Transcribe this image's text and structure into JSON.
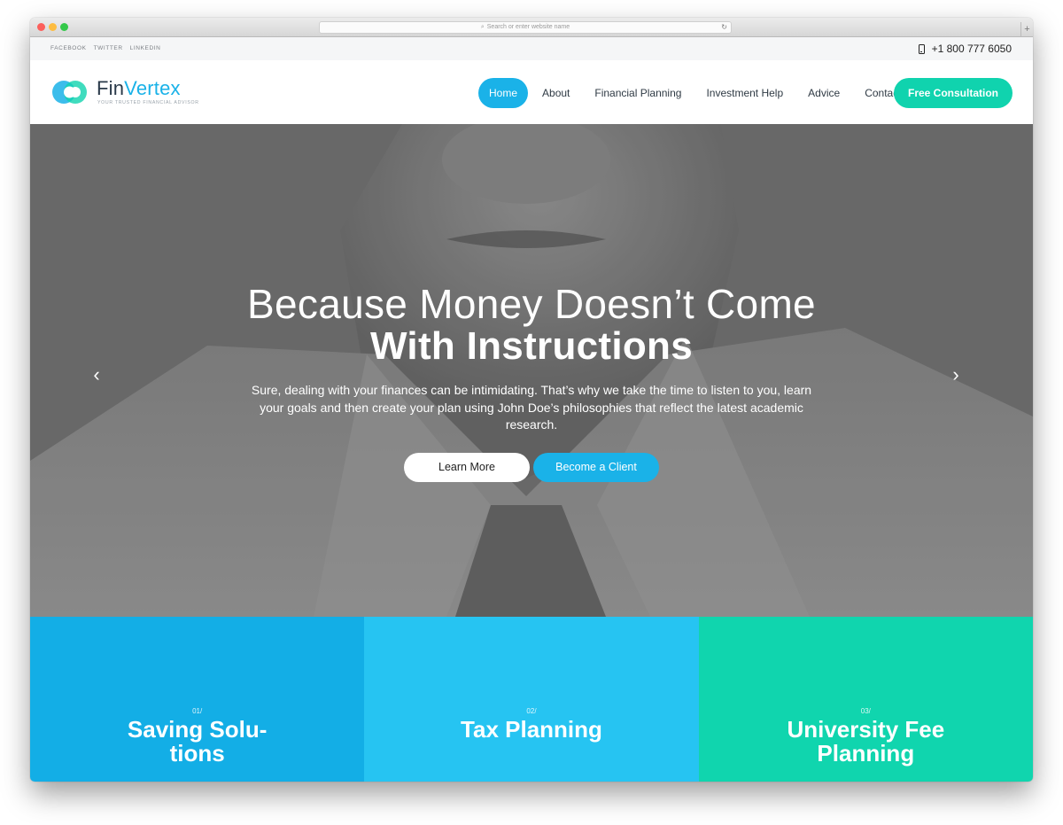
{
  "browser": {
    "url_placeholder": "Search or enter website name",
    "reload_glyph": "↻",
    "newtab_glyph": "+"
  },
  "topbar": {
    "social": [
      "FACEBOOK",
      "TWITTER",
      "LINKEDIN"
    ],
    "phone": "+1 800 777 6050"
  },
  "logo": {
    "name_part1": "Fin",
    "name_part2": "Vertex",
    "tagline": "YOUR TRUSTED FINANCIAL ADVISOR"
  },
  "nav": {
    "items": [
      "Home",
      "About",
      "Financial Planning",
      "Investment Help",
      "Advice",
      "Contacts"
    ],
    "active": "Home",
    "cta": "Free Consultation"
  },
  "hero": {
    "title_line1": "Because Money Doesn’t Come",
    "title_line2": "With Instructions",
    "subtitle": "Sure, dealing with your finances can be intimidating. That’s why we take the time to listen to you, learn your goals and then create your plan using John Doe’s philosophies that reflect the latest academic research.",
    "btn_primary": "Learn More",
    "btn_secondary": "Become a Client",
    "prev_glyph": "‹",
    "next_glyph": "›"
  },
  "services": [
    {
      "num": "01/",
      "line1": "Saving Solu-",
      "line2": "tions",
      "color": "#13aee6"
    },
    {
      "num": "02/",
      "line1": "Tax Planning",
      "line2": "",
      "color": "#26c4f2"
    },
    {
      "num": "03/",
      "line1": "University Fee",
      "line2": "Planning",
      "color": "#10d5ae"
    }
  ],
  "colors": {
    "accent_blue": "#1ab2e8",
    "accent_green": "#10d3ae"
  }
}
